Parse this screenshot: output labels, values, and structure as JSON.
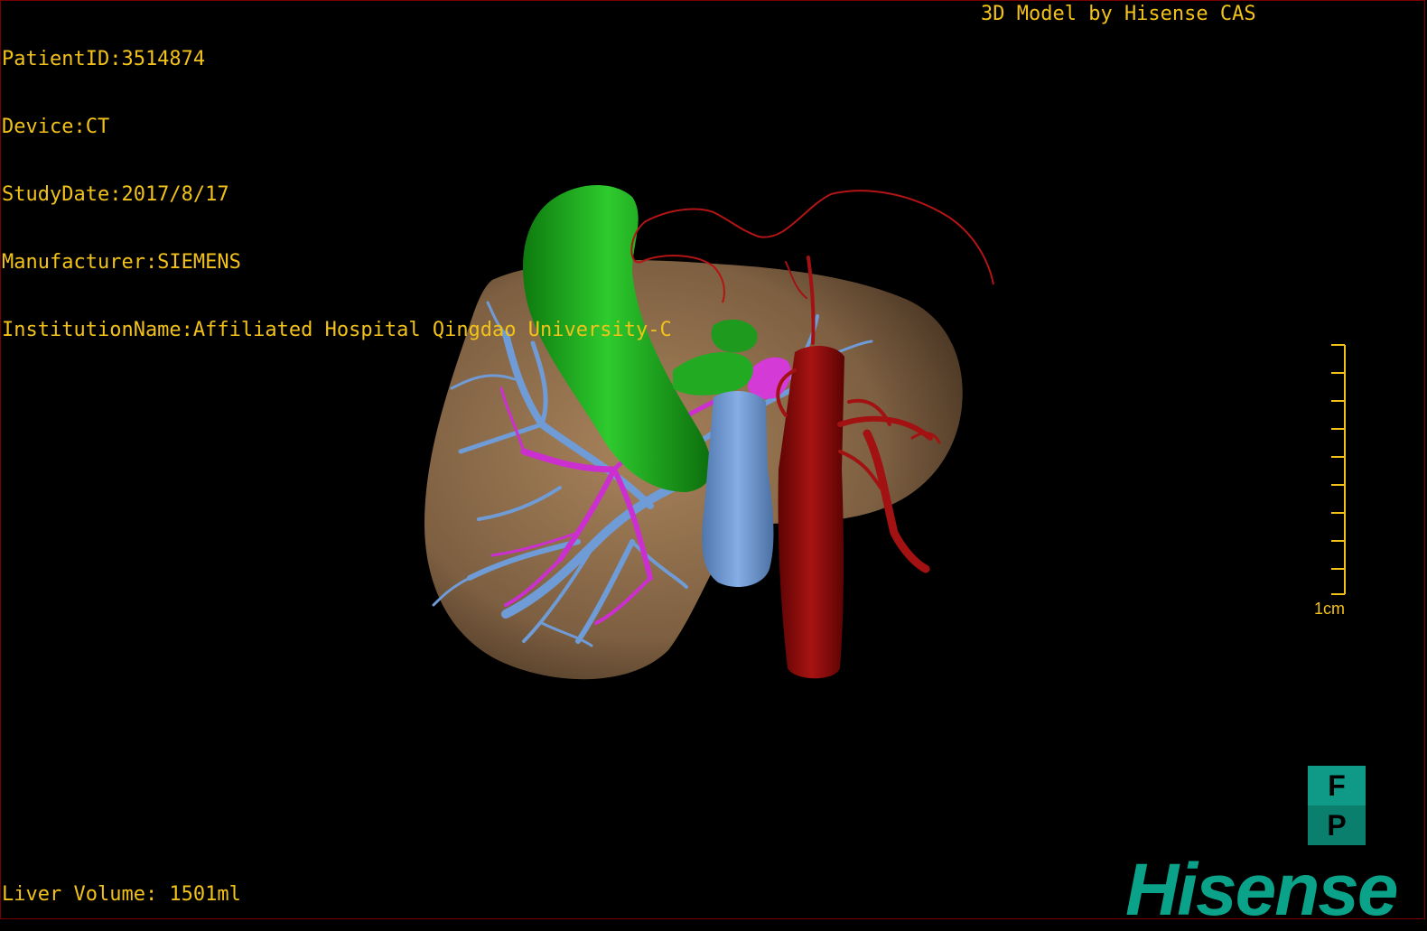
{
  "patient_info": {
    "patient_id": "PatientID:3514874",
    "device": "Device:CT",
    "study_date": "StudyDate:2017/8/17",
    "manufacturer": "Manufacturer:SIEMENS",
    "institution": "InstitutionName:Affiliated Hospital Qingdao University-C"
  },
  "header": {
    "credit": "3D Model by Hisense CAS"
  },
  "footer": {
    "liver_volume": "Liver Volume: 1501ml"
  },
  "scale": {
    "label": "1cm"
  },
  "orientation": {
    "top_face": "F",
    "bottom_face": "P"
  },
  "brand": {
    "logo_text": "Hisense"
  },
  "colors": {
    "overlay_text": "#f2c21a",
    "liver": "#8a6b4a",
    "gallbladder": "#22aa22",
    "portal_vein": "#6f9bd6",
    "hepatic_vein": "#cc2fd0",
    "artery": "#8c0a0a",
    "brand": "#0aa38a"
  },
  "icons": {
    "orientation": "orientation-cube-icon"
  }
}
